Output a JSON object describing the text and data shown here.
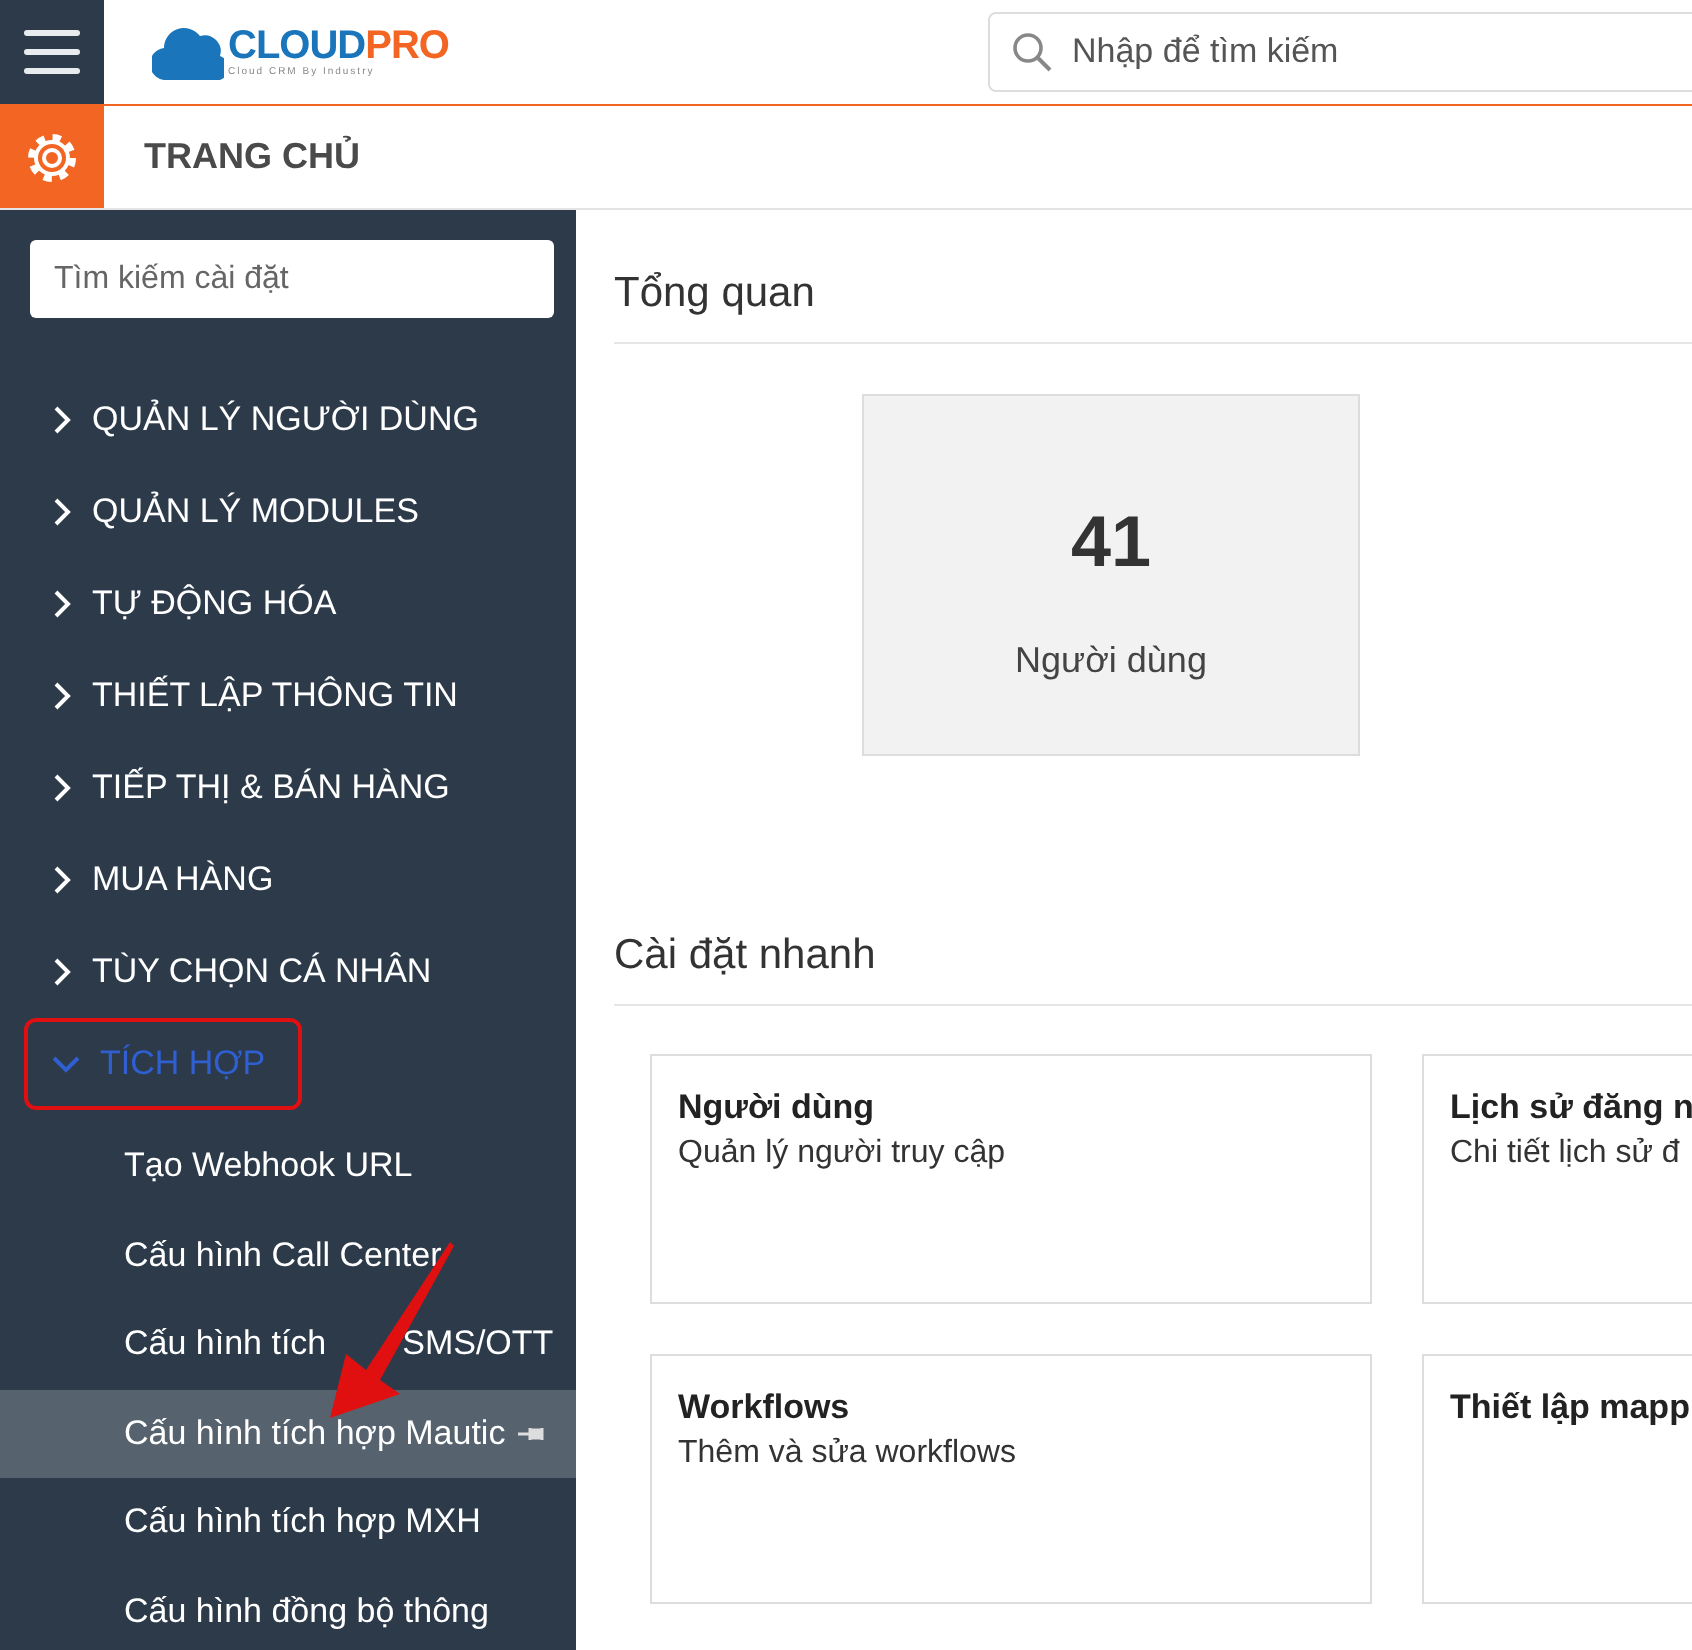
{
  "header": {
    "logo": {
      "primary": "CLOUD",
      "accent": "PRO",
      "tagline": "Cloud CRM By Industry"
    },
    "search": {
      "placeholder": "Nhập để tìm kiếm"
    }
  },
  "breadcrumb": "TRANG CHỦ",
  "sidebar": {
    "search": {
      "placeholder": "Tìm kiếm cài đặt"
    },
    "items": [
      {
        "label": "QUẢN LÝ NGƯỜI DÙNG",
        "expanded": false,
        "highlighted": false
      },
      {
        "label": "QUẢN LÝ MODULES",
        "expanded": false,
        "highlighted": false
      },
      {
        "label": "TỰ ĐỘNG HÓA",
        "expanded": false,
        "highlighted": false
      },
      {
        "label": "THIẾT LẬP THÔNG TIN",
        "expanded": false,
        "highlighted": false
      },
      {
        "label": "TIẾP THỊ & BÁN HÀNG",
        "expanded": false,
        "highlighted": false
      },
      {
        "label": "MUA HÀNG",
        "expanded": false,
        "highlighted": false
      },
      {
        "label": "TÙY CHỌN CÁ NHÂN",
        "expanded": false,
        "highlighted": false
      },
      {
        "label": "TÍCH HỢP",
        "expanded": true,
        "highlighted": true,
        "children": [
          {
            "label": "Tạo Webhook URL",
            "selected": false
          },
          {
            "label": "Cấu hình Call Center",
            "selected": false
          },
          {
            "label": "Cấu hình tích",
            "label_after": "SMS/OTT",
            "selected": false
          },
          {
            "label": "Cấu hình tích hợp Mautic",
            "selected": true
          },
          {
            "label": "Cấu hình tích hợp MXH",
            "selected": false
          },
          {
            "label": "Cấu hình đồng bộ thông",
            "selected": false
          }
        ]
      }
    ]
  },
  "overview": {
    "title": "Tổng quan",
    "stat": {
      "value": "41",
      "label": "Người dùng"
    }
  },
  "quick_settings": {
    "title": "Cài đặt nhanh",
    "cards": [
      {
        "title": "Người dùng",
        "description": "Quản lý người truy cập"
      },
      {
        "title": "Lịch sử đăng n",
        "description": "Chi tiết lịch sử đ"
      },
      {
        "title": "Workflows",
        "description": "Thêm và sửa workflows"
      },
      {
        "title": "Thiết lập mapp"
      }
    ]
  }
}
